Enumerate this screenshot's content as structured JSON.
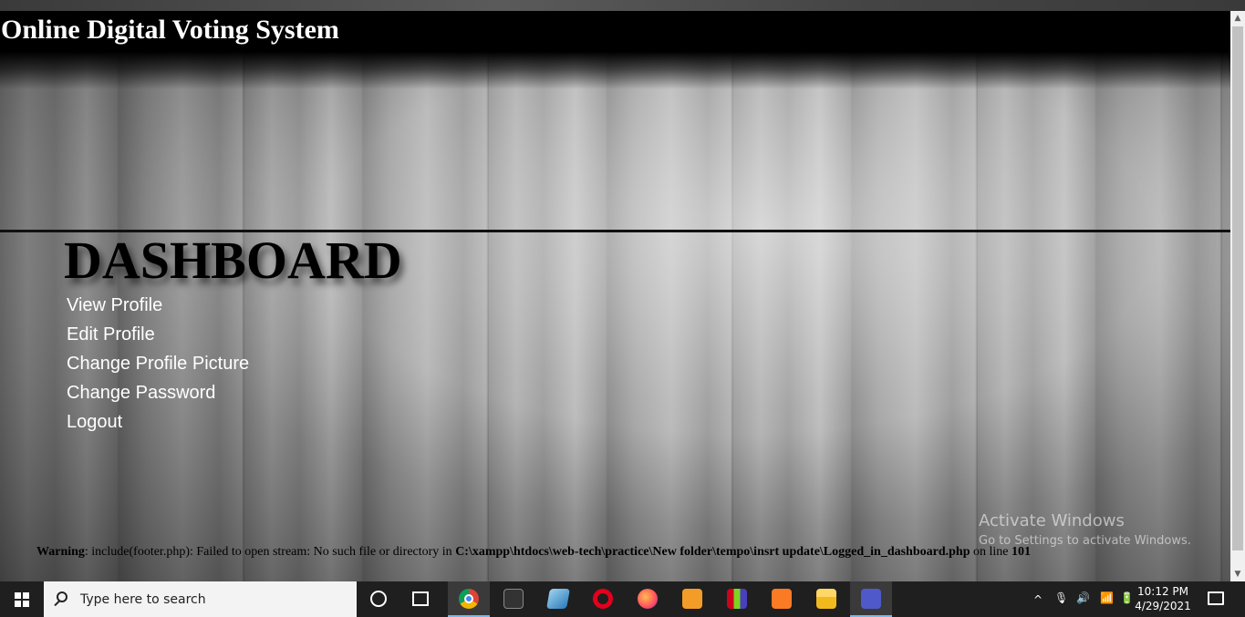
{
  "header": {
    "site_title": "Online Digital Voting System"
  },
  "dashboard": {
    "title": "DASHBOARD"
  },
  "menu": [
    {
      "label": "View Profile"
    },
    {
      "label": "Edit Profile"
    },
    {
      "label": "Change Profile Picture"
    },
    {
      "label": "Change Password"
    },
    {
      "label": "Logout"
    }
  ],
  "warning": {
    "label": "Warning",
    "message": ": include(footer.php): Failed to open stream: No such file or directory in ",
    "path": "C:\\xampp\\htdocs\\web-tech\\practice\\New folder\\tempo\\insrt update\\Logged_in_dashboard.php",
    "line_text": " on line ",
    "line_number": "101"
  },
  "watermark": {
    "line1": "Activate Windows",
    "line2": "Go to Settings to activate Windows."
  },
  "taskbar": {
    "search_placeholder": "Type here to search",
    "time": "10:12 PM",
    "date": "4/29/2021",
    "apps": [
      "cortana-icon",
      "task-view-icon",
      "chrome-icon",
      "notion-icon",
      "app-icon",
      "opera-icon",
      "firefox-icon",
      "sublime-icon",
      "winrar-icon",
      "xampp-icon",
      "file-explorer-icon",
      "teams-icon"
    ]
  },
  "colors": {
    "menu_text": "#ffffff",
    "header_bg": "#000000",
    "taskbar_bg": "#1f1f1f"
  }
}
